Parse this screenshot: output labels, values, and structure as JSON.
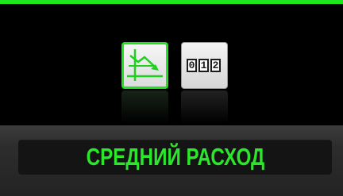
{
  "screen": {
    "title": "СРЕДНИЙ РАСХОД",
    "accent_color": "#1ee61e",
    "label_color": "#2ce62c"
  },
  "icons": [
    {
      "name": "average-consumption-icon",
      "selected": true
    },
    {
      "name": "odometer-icon",
      "selected": false,
      "digits": [
        "0",
        "1",
        "2"
      ]
    }
  ]
}
